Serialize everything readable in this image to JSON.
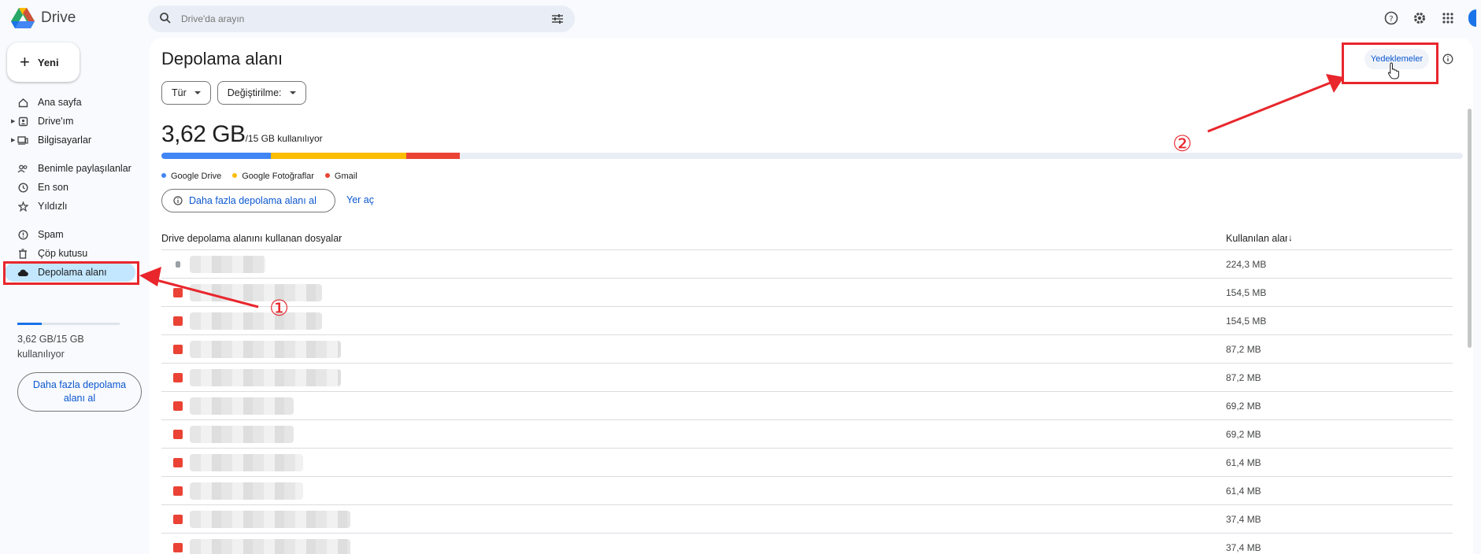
{
  "app": {
    "name": "Drive"
  },
  "search": {
    "placeholder": "Drive'da arayın"
  },
  "new_button": {
    "label": "Yeni"
  },
  "sidebar": {
    "items": [
      {
        "label": "Ana sayfa",
        "icon": "home-icon"
      },
      {
        "label": "Drive'ım",
        "icon": "my-drive-icon"
      },
      {
        "label": "Bilgisayarlar",
        "icon": "computer-icon"
      },
      {
        "label": "Benimle paylaşılanlar",
        "icon": "shared-icon"
      },
      {
        "label": "En son",
        "icon": "clock-icon"
      },
      {
        "label": "Yıldızlı",
        "icon": "star-icon"
      },
      {
        "label": "Spam",
        "icon": "spam-icon"
      },
      {
        "label": "Çöp kutusu",
        "icon": "trash-icon"
      },
      {
        "label": "Depolama alanı",
        "icon": "cloud-icon",
        "active": true
      }
    ],
    "storage_text": "3,62 GB/15 GB kullanılıyor",
    "storage_fraction": 0.24,
    "more_storage": "Daha fazla depolama alanı al"
  },
  "main": {
    "title": "Depolama alanı",
    "backups_button": "Yedeklemeler",
    "filters": [
      "Tür",
      "Değiştirilme:"
    ],
    "usage_big": "3,62 GB",
    "usage_small": "/15 GB kullanılıyor",
    "bar_segments": [
      {
        "name": "Google Drive",
        "fraction": 0.084,
        "color": "#4285f4"
      },
      {
        "name": "Google Fotoğraflar",
        "fraction": 0.104,
        "color": "#fbbc04"
      },
      {
        "name": "Gmail",
        "fraction": 0.041,
        "color": "#ea4335"
      }
    ],
    "get_more": "Daha fazla depolama alanı al",
    "free_up": "Yer aç",
    "table": {
      "col_files": "Drive depolama alanını kullanan dosyalar",
      "col_size": "Kullanılan alan",
      "rows": [
        {
          "size": "224,3 MB",
          "icon": "file-icon",
          "color": "#9aa0a6"
        },
        {
          "size": "154,5 MB",
          "icon": "file-icon",
          "color": "#ea4335"
        },
        {
          "size": "154,5 MB",
          "icon": "video-icon",
          "color": "#ea4335"
        },
        {
          "size": "87,2 MB",
          "icon": "archive-icon",
          "color": "#ea4335"
        },
        {
          "size": "87,2 MB",
          "icon": "archive-icon",
          "color": "#ea4335"
        },
        {
          "size": "69,2 MB",
          "icon": "archive-icon",
          "color": "#ea4335"
        },
        {
          "size": "69,2 MB",
          "icon": "archive-icon",
          "color": "#ea4335"
        },
        {
          "size": "61,4 MB",
          "icon": "archive-icon",
          "color": "#ea4335"
        },
        {
          "size": "61,4 MB",
          "icon": "archive-icon",
          "color": "#ea4335"
        },
        {
          "size": "37,4 MB",
          "icon": "archive-icon",
          "color": "#ea4335"
        },
        {
          "size": "37,4 MB",
          "icon": "archive-icon",
          "color": "#ea4335"
        }
      ]
    }
  },
  "annotations": {
    "n1": "①",
    "n2": "②"
  }
}
